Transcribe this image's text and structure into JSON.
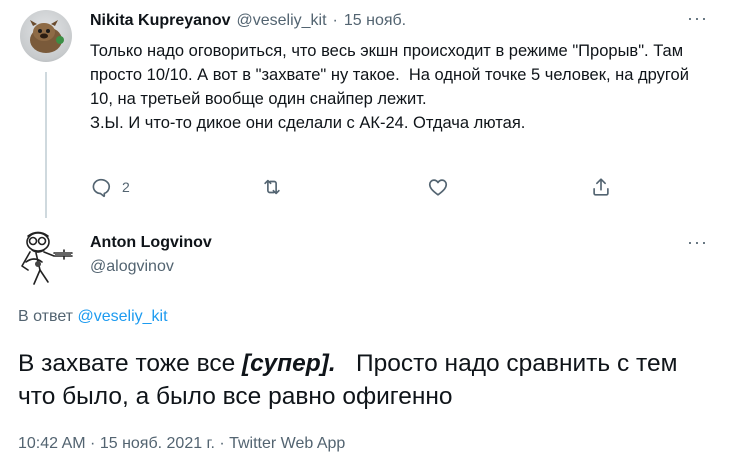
{
  "parent_tweet": {
    "author_name": "Nikita Kupreyanov",
    "author_handle": "@veseliy_kit",
    "separator": "·",
    "date": "15 нояб.",
    "more_icon": "more-icon",
    "text": "Только надо оговориться, что весь экшн происходит в режиме \"Прорыв\". Там просто 10/10. А вот в \"захвате\" ну такое.  На одной точке 5 человек, на другой 10, на третьей вообще один снайпер лежит.\nЗ.Ы. И что-то дикое они сделали с АК-24. Отдача лютая.",
    "reply_count": "2",
    "retweet_count": "",
    "like_count": ""
  },
  "main_tweet": {
    "author_name": "Anton Logvinov",
    "author_handle": "@alogvinov",
    "reply_prefix": "В ответ",
    "reply_mention": "@veseliy_kit",
    "text_part1": "В захвате тоже все ",
    "text_emph": "[супер].",
    "text_part2": "   Просто надо сравнить с тем что было, а было все равно офигенно",
    "timestamp": "10:42 AM · 15 нояб. 2021 г. · Twitter Web App"
  },
  "colors": {
    "text": "#0f1419",
    "secondary": "#536471",
    "link": "#1d9bf0",
    "thread_line": "#cfd9de"
  }
}
